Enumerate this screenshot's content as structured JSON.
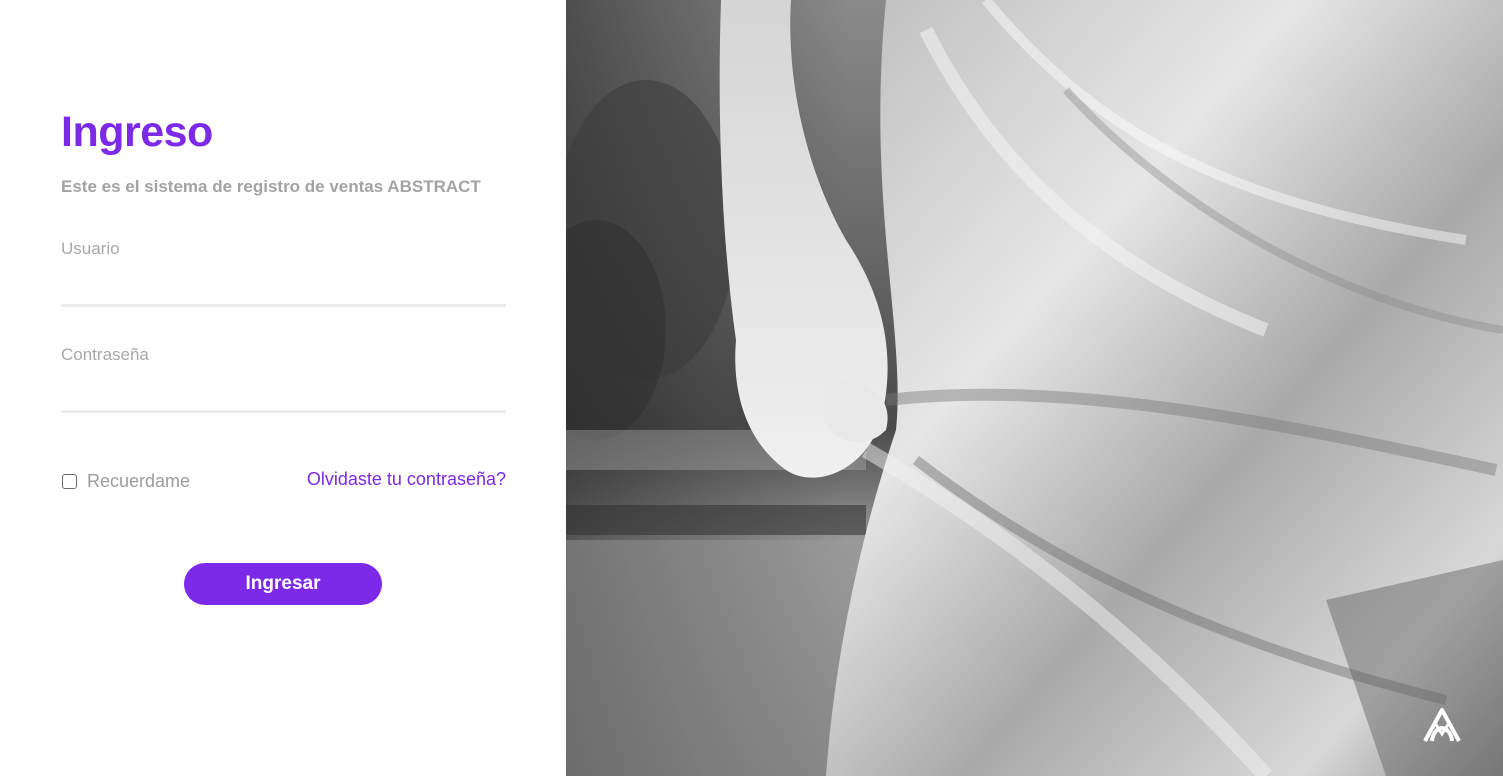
{
  "login": {
    "title": "Ingreso",
    "subtitle": "Este es el sistema de registro de ventas ABSTRACT",
    "username_label": "Usuario",
    "username_value": "",
    "password_label": "Contraseña",
    "password_value": "",
    "remember_label": "Recuerdame",
    "remember_checked": false,
    "forgot_link": "Olvidaste tu contraseña?",
    "submit_label": "Ingresar"
  },
  "hero": {
    "image_subject": "black-and-white statue draped fabric photo",
    "logo_icon": "abstract-brand-logo-icon"
  },
  "colors": {
    "accent": "#7c2ae8",
    "muted_text": "#a3a3a3",
    "input_line": "#ececec",
    "button_text": "#ffffff"
  }
}
